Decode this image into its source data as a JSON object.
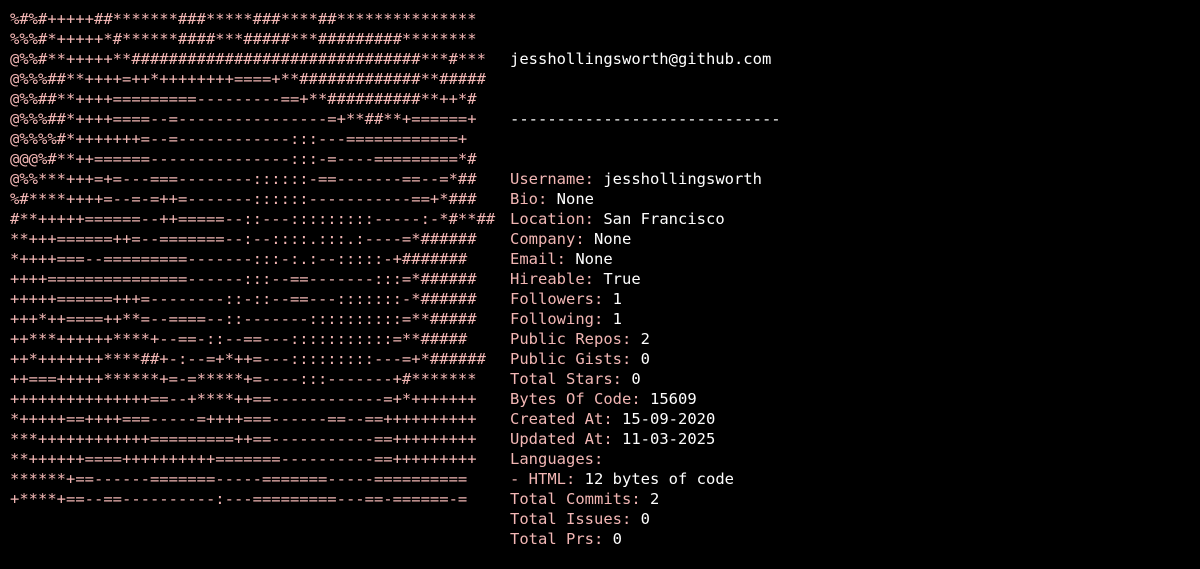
{
  "colors": {
    "background": "#000000",
    "art": "#f2b6b4",
    "label": "#f2b6b4",
    "value": "#ffffff"
  },
  "ascii_art": [
    "%#%#+++++##*******###*****###****##***************",
    "%%%#*+++++*#******####***#####***#########********",
    "@%%#**+++++**###############################***#***",
    "@%%%##**++++=++*++++++++====+**#############**#####",
    "@%%##**++++=========---------==+**##########**++*#",
    "@%%%##*++++====--=----------------=+**##**+======+",
    "@%%%%#*+++++++=--=------------:::---============+",
    "@@@%#**++======---------------:::-=----=========*#",
    "@%%***+++=+=---===--------::::::-==-------==--=*##",
    "%#****++++=--=-=++=-------::::::-----------==+*###",
    "#**+++++======--++=====--::---:::::::::-----:-*#**##",
    "**+++======++=--=======--:--::::.:::.:----=*######",
    "*++++===--=========-------:::-:.:--:::::-+#######",
    "++++===============------:::--==-------:::=*######",
    "+++++======+++=--------::-::--==---:::::::-*######",
    "+++*++====++**=--====--::-------::::::::::=**#####",
    "++***++++++****+--==-::--==---:::::::::::=**#####",
    "++*+++++++****##+-:--=+*++=---:::::::::---=+*######",
    "++===+++++******+=-=*****+=----:::-------+#*******",
    "+++++++++++++++==--+****++==------------=+*+++++++",
    "*+++++==++++===-----=++++===------==--==++++++++++",
    "***++++++++++++=========++==-----------==+++++++++",
    "**++++++====++++++++++=======----------==+++++++++",
    "******+==------=======-----=======-----==========",
    "+****+==--==----------:---=========---==-======-="
  ],
  "profile": {
    "header": "jesshollingsworth@github.com",
    "divider": "-----------------------------",
    "fields": [
      {
        "label": "Username:",
        "value": "jesshollingsworth"
      },
      {
        "label": "Bio:",
        "value": "None"
      },
      {
        "label": "Location:",
        "value": "San Francisco"
      },
      {
        "label": "Company:",
        "value": "None"
      },
      {
        "label": "Email:",
        "value": "None"
      },
      {
        "label": "Hireable:",
        "value": "True"
      },
      {
        "label": "Followers:",
        "value": "1"
      },
      {
        "label": "Following:",
        "value": "1"
      },
      {
        "label": "Public Repos:",
        "value": "2"
      },
      {
        "label": "Public Gists:",
        "value": "0"
      },
      {
        "label": "Total Stars:",
        "value": "0"
      },
      {
        "label": "Bytes Of Code:",
        "value": "15609"
      },
      {
        "label": "Created At:",
        "value": "15-09-2020"
      },
      {
        "label": "Updated At:",
        "value": "11-03-2025"
      },
      {
        "label": "Languages:",
        "value": ""
      },
      {
        "label": "- HTML:",
        "value": "12 bytes of code"
      },
      {
        "label": "Total Commits:",
        "value": "2"
      },
      {
        "label": "Total Issues:",
        "value": "0"
      },
      {
        "label": "Total Prs:",
        "value": "0"
      }
    ]
  }
}
